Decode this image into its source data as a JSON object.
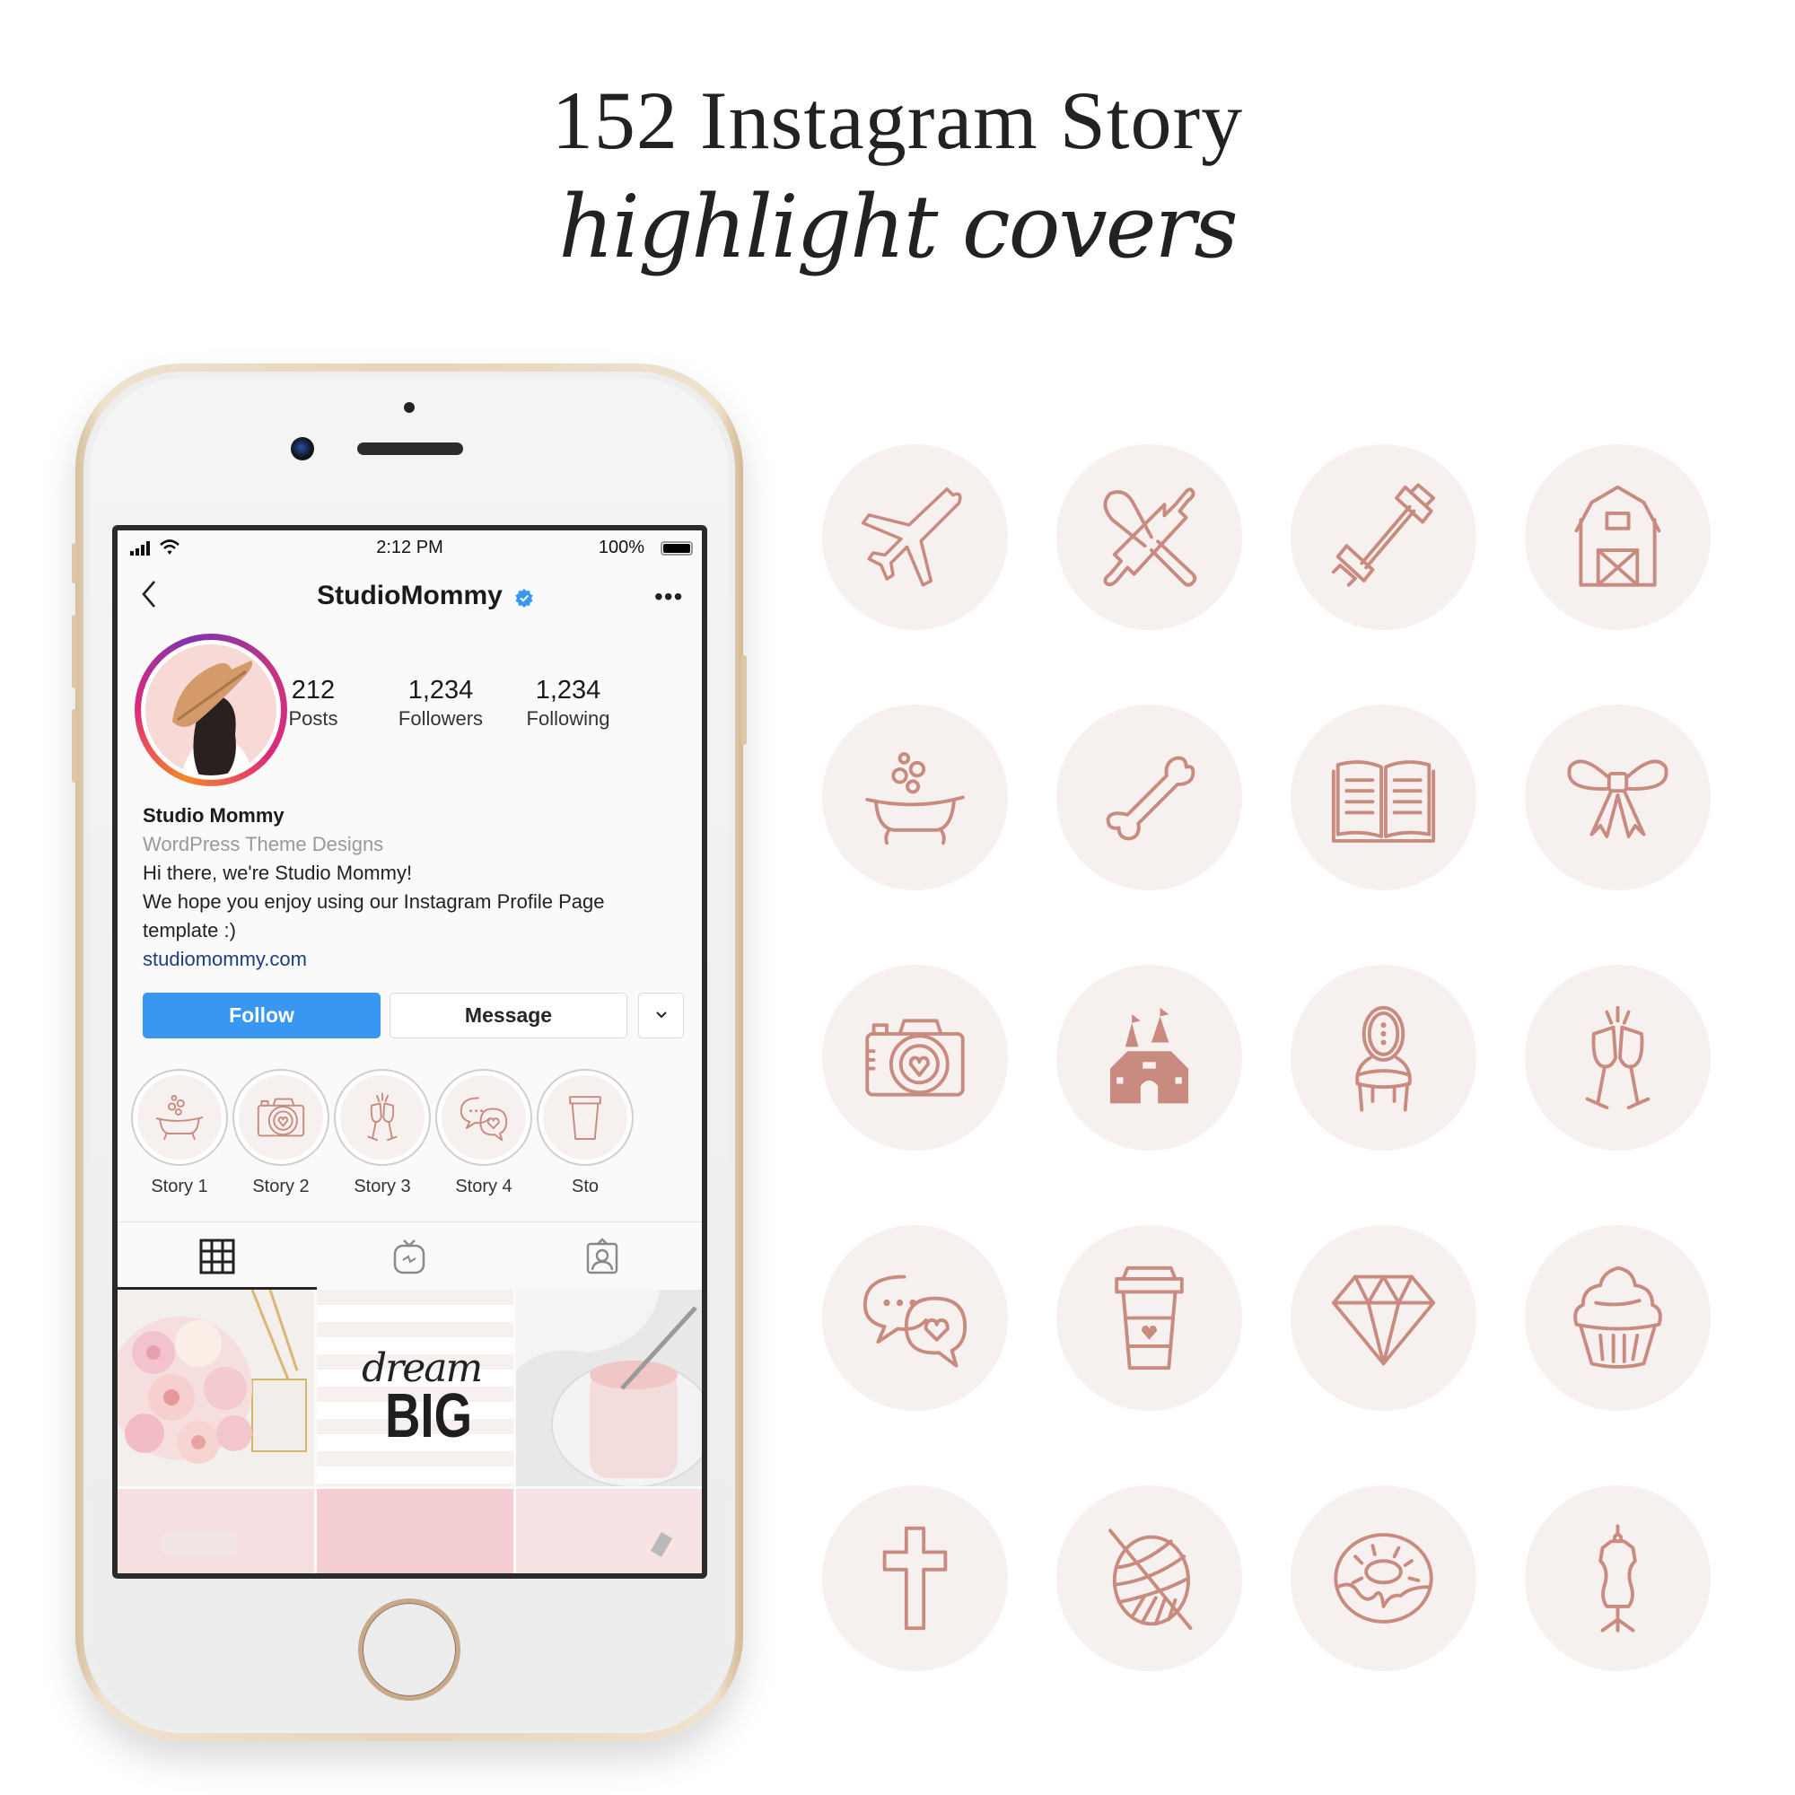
{
  "header": {
    "title": "152 Instagram Story",
    "subtitle": "highlight covers"
  },
  "status_bar": {
    "time": "2:12 PM",
    "battery": "100%"
  },
  "profile": {
    "username": "StudioMommy",
    "verified": true,
    "stats": [
      {
        "value": "212",
        "label": "Posts"
      },
      {
        "value": "1,234",
        "label": "Followers"
      },
      {
        "value": "1,234",
        "label": "Following"
      }
    ],
    "display_name": "Studio Mommy",
    "category": "WordPress Theme Designs",
    "bio_lines": [
      "Hi there, we're Studio Mommy!",
      "We hope you enjoy using our Instagram Profile Page",
      "template :)"
    ],
    "website": "studiomommy.com"
  },
  "buttons": {
    "follow": "Follow",
    "message": "Message",
    "more": "⌄"
  },
  "highlights": [
    {
      "label": "Story 1",
      "icon": "bathtub-icon"
    },
    {
      "label": "Story 2",
      "icon": "camera-icon"
    },
    {
      "label": "Story 3",
      "icon": "champagne-icon"
    },
    {
      "label": "Story 4",
      "icon": "chat-bubbles-icon"
    },
    {
      "label": "Sto",
      "icon": "coffee-cup-icon"
    }
  ],
  "profile_tabs": [
    "grid",
    "igtv",
    "tagged"
  ],
  "posts": [
    {
      "kind": "photo",
      "subject": "pink roses bouquet"
    },
    {
      "kind": "quote",
      "script": "dream",
      "bold": "BIG"
    },
    {
      "kind": "photo",
      "subject": "pink smoothie jar"
    },
    {
      "kind": "photo",
      "subject": "pink paint stroke"
    },
    {
      "kind": "photo",
      "subject": "pink brick wall"
    },
    {
      "kind": "photo",
      "subject": "pink tube"
    }
  ],
  "colors": {
    "accent_blue": "#3897f0",
    "rose_gold": "#c98a80",
    "cover_bg": "#f6f1ef",
    "phone_gold": "#e6d4bb"
  },
  "covers": [
    "airplane-icon",
    "whisk-rolling-pin-icon",
    "dumbbell-icon",
    "barn-icon",
    "bathtub-icon",
    "bone-icon",
    "open-book-icon",
    "bow-icon",
    "camera-icon",
    "castle-icon",
    "chair-icon",
    "champagne-icon",
    "chat-bubbles-icon",
    "coffee-cup-icon",
    "diamond-icon",
    "cupcake-icon",
    "cross-icon",
    "yarn-ball-icon",
    "donut-icon",
    "dress-form-icon"
  ]
}
